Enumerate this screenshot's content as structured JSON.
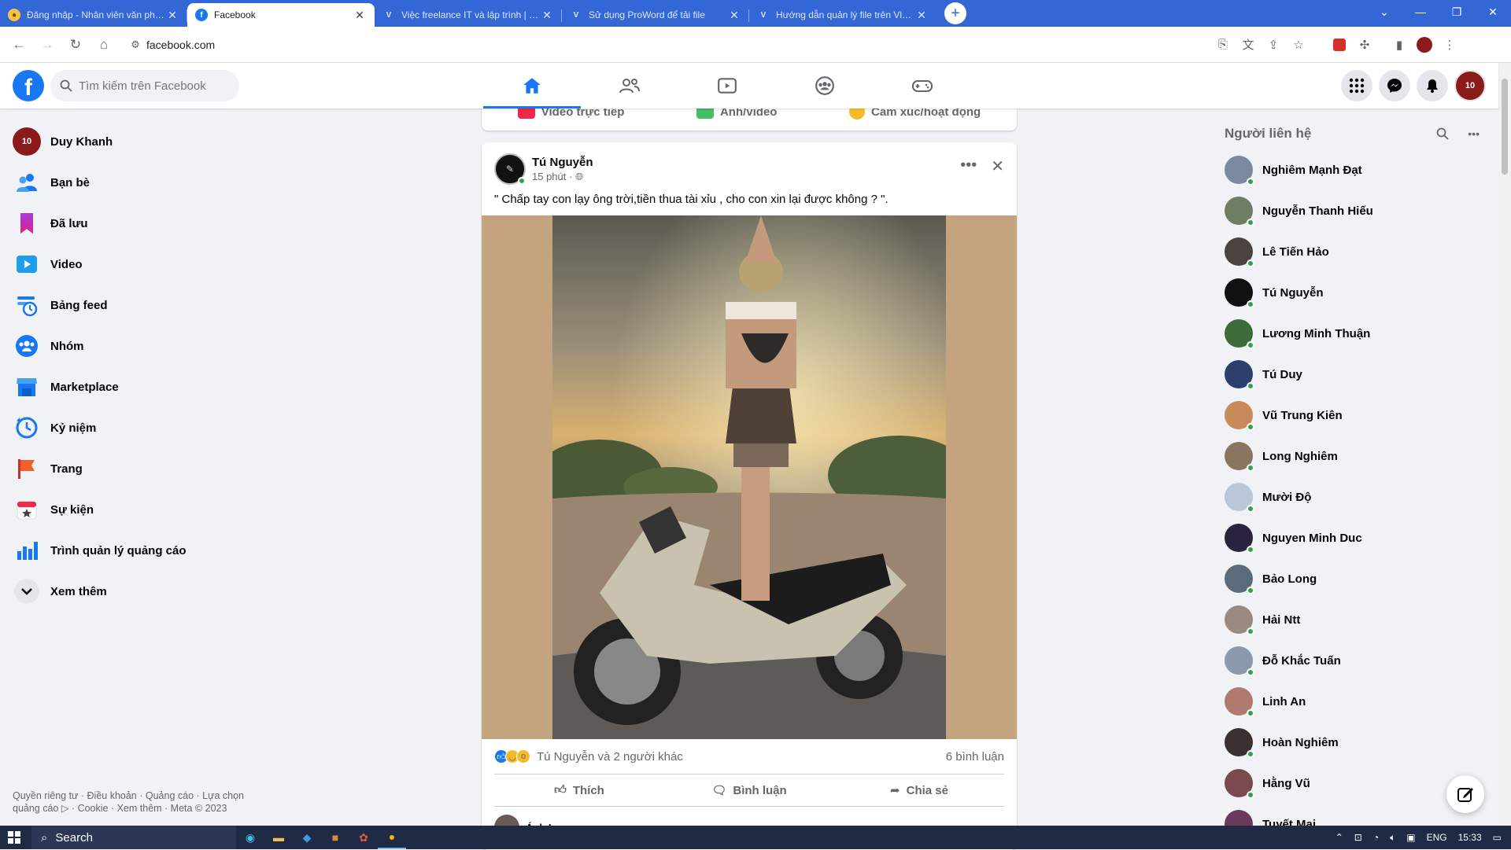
{
  "browser": {
    "tabs": [
      {
        "title": "Đăng nhập - Nhân viên văn phòng",
        "active": false
      },
      {
        "title": "Facebook",
        "active": true
      },
      {
        "title": "Việc freelance IT và lập trình | Vlance",
        "active": false
      },
      {
        "title": "Sử dụng ProWord để tải file",
        "active": false
      },
      {
        "title": "Hướng dẫn quản lý file trên Vlance",
        "active": false
      }
    ],
    "url": "facebook.com"
  },
  "facebook": {
    "search_placeholder": "Tìm kiếm trên Facebook",
    "sidebar": [
      {
        "label": "Duy Khanh",
        "icon": "avatar-icon"
      },
      {
        "label": "Bạn bè",
        "icon": "friends-icon"
      },
      {
        "label": "Đã lưu",
        "icon": "bookmark-icon"
      },
      {
        "label": "Video",
        "icon": "video-icon"
      },
      {
        "label": "Bảng feed",
        "icon": "feed-icon"
      },
      {
        "label": "Nhóm",
        "icon": "groups-icon"
      },
      {
        "label": "Marketplace",
        "icon": "marketplace-icon"
      },
      {
        "label": "Kỷ niệm",
        "icon": "memories-icon"
      },
      {
        "label": "Trang",
        "icon": "pages-icon"
      },
      {
        "label": "Sự kiện",
        "icon": "events-icon"
      },
      {
        "label": "Trình quản lý quảng cáo",
        "icon": "ads-manager-icon"
      },
      {
        "label": "Xem thêm",
        "icon": "chevron-down-icon"
      }
    ],
    "footer": {
      "line1": "Quyền riêng tư · Điều khoản · Quảng cáo · Lựa chọn",
      "line2": "quảng cáo ▷ · Cookie · Xem thêm · Meta © 2023"
    },
    "composer": {
      "live": "Video trực tiếp",
      "photo": "Ảnh/video",
      "feeling": "Cảm xúc/hoạt động"
    },
    "post": {
      "author": "Tú Nguyễn",
      "time": "15 phút · ",
      "text": "\" Chấp tay con lạy ông trời,tiền thua tài xỉu , cho con xin lại được không ? \".",
      "reactions_text": "Tú Nguyễn và 2 người khác",
      "comments_count": "6 bình luận",
      "like_label": "Thích",
      "comment_label": "Bình luận",
      "share_label": "Chia sẻ",
      "next_commenter": "Ánh Lan"
    },
    "contacts": {
      "title": "Người liên hệ",
      "list": [
        {
          "name": "Nghiêm Mạnh Đạt",
          "color": "#7a8aa0"
        },
        {
          "name": "Nguyễn Thanh Hiếu",
          "color": "#6f7d62"
        },
        {
          "name": "Lê Tiến Hảo",
          "color": "#4a4340"
        },
        {
          "name": "Tú Nguyễn",
          "color": "#111111"
        },
        {
          "name": "Lương Minh Thuận",
          "color": "#3d6b3a"
        },
        {
          "name": "Tú Duy",
          "color": "#2e3f6e"
        },
        {
          "name": "Vũ Trung Kiên",
          "color": "#c98a5a"
        },
        {
          "name": "Long Nghiêm",
          "color": "#8a7560"
        },
        {
          "name": "Mười Độ",
          "color": "#b9c7d8"
        },
        {
          "name": "Nguyen Minh Duc",
          "color": "#2b2440"
        },
        {
          "name": "Bảo Long",
          "color": "#5a6b7a"
        },
        {
          "name": "Hải Ntt",
          "color": "#9a8a80"
        },
        {
          "name": "Đỗ Khắc Tuấn",
          "color": "#8a9aac"
        },
        {
          "name": "Linh An",
          "color": "#b07a70"
        },
        {
          "name": "Hoàn Nghiêm",
          "color": "#3a3030"
        },
        {
          "name": "Hằng Vũ",
          "color": "#7a4a50"
        },
        {
          "name": "Tuyết Mai",
          "color": "#6a3a5a"
        }
      ]
    }
  },
  "taskbar": {
    "search": "Search",
    "lang": "ENG",
    "time": "15:33"
  },
  "colors": {
    "fb_blue": "#1877f2",
    "chrome_blue": "#3367d6",
    "online": "#31a24c"
  }
}
